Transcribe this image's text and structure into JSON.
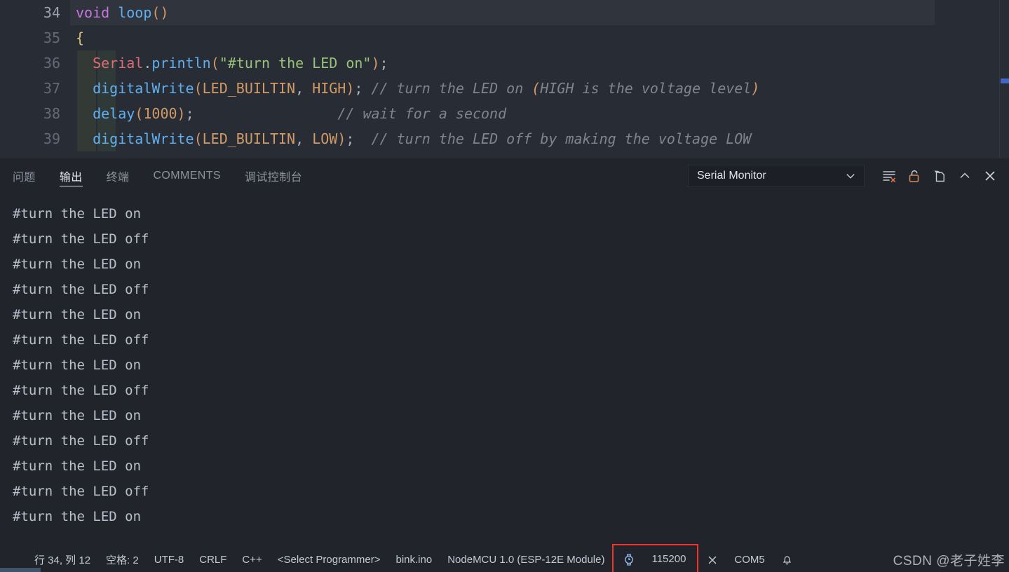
{
  "editor": {
    "lines": [
      {
        "number": "34",
        "active": true,
        "indent_guides": 0,
        "tokens": [
          {
            "t": "void",
            "c": "t-kw"
          },
          {
            "t": " ",
            "c": "t-plain"
          },
          {
            "t": "loop",
            "c": "t-fn"
          },
          {
            "t": "(",
            "c": "t-paren"
          },
          {
            "t": ")",
            "c": "t-paren"
          }
        ]
      },
      {
        "number": "35",
        "active": false,
        "indent_guides": 0,
        "tokens": [
          {
            "t": "{",
            "c": "t-brace"
          }
        ]
      },
      {
        "number": "36",
        "active": false,
        "indent_guides": 2,
        "tokens": [
          {
            "t": "  ",
            "c": "t-plain"
          },
          {
            "t": "Serial",
            "c": "t-obj"
          },
          {
            "t": ".",
            "c": "t-plain"
          },
          {
            "t": "println",
            "c": "t-fn"
          },
          {
            "t": "(",
            "c": "t-paren"
          },
          {
            "t": "\"#turn the LED on\"",
            "c": "t-str"
          },
          {
            "t": ")",
            "c": "t-paren"
          },
          {
            "t": ";",
            "c": "t-semi"
          }
        ]
      },
      {
        "number": "37",
        "active": false,
        "indent_guides": 2,
        "tokens": [
          {
            "t": "  ",
            "c": "t-plain"
          },
          {
            "t": "digitalWrite",
            "c": "t-fn"
          },
          {
            "t": "(",
            "c": "t-paren"
          },
          {
            "t": "LED_BUILTIN",
            "c": "t-const"
          },
          {
            "t": ", ",
            "c": "t-plain"
          },
          {
            "t": "HIGH",
            "c": "t-const"
          },
          {
            "t": ")",
            "c": "t-paren"
          },
          {
            "t": ";",
            "c": "t-semi"
          },
          {
            "t": " // turn the LED on ",
            "c": "t-cmt"
          },
          {
            "t": "(",
            "c": "t-cmt-paren"
          },
          {
            "t": "HIGH is the voltage level",
            "c": "t-cmt"
          },
          {
            "t": ")",
            "c": "t-cmt-paren"
          }
        ]
      },
      {
        "number": "38",
        "active": false,
        "indent_guides": 2,
        "tokens": [
          {
            "t": "  ",
            "c": "t-plain"
          },
          {
            "t": "delay",
            "c": "t-fn"
          },
          {
            "t": "(",
            "c": "t-paren"
          },
          {
            "t": "1000",
            "c": "t-const"
          },
          {
            "t": ")",
            "c": "t-paren"
          },
          {
            "t": ";",
            "c": "t-semi"
          },
          {
            "t": "                 // wait for a second",
            "c": "t-cmt"
          }
        ]
      },
      {
        "number": "39",
        "active": false,
        "indent_guides": 2,
        "tokens": [
          {
            "t": "  ",
            "c": "t-plain"
          },
          {
            "t": "digitalWrite",
            "c": "t-fn"
          },
          {
            "t": "(",
            "c": "t-paren"
          },
          {
            "t": "LED_BUILTIN",
            "c": "t-const"
          },
          {
            "t": ", ",
            "c": "t-plain"
          },
          {
            "t": "LOW",
            "c": "t-const"
          },
          {
            "t": ")",
            "c": "t-paren"
          },
          {
            "t": ";",
            "c": "t-semi"
          },
          {
            "t": "  // turn the LED off by making the voltage LOW",
            "c": "t-cmt"
          }
        ]
      }
    ]
  },
  "panel": {
    "tabs": [
      {
        "label": "问题",
        "active": false,
        "name": "tab-problems"
      },
      {
        "label": "输出",
        "active": true,
        "name": "tab-output"
      },
      {
        "label": "终端",
        "active": false,
        "name": "tab-terminal"
      },
      {
        "label": "COMMENTS",
        "active": false,
        "name": "tab-comments"
      },
      {
        "label": "调试控制台",
        "active": false,
        "name": "tab-debug-console"
      }
    ],
    "channel_selected": "Serial Monitor",
    "actions": [
      {
        "name": "clear-output-icon",
        "title": "清除输出"
      },
      {
        "name": "unlock-icon",
        "title": "解锁滚动"
      },
      {
        "name": "open-new-window-icon",
        "title": "在新窗口中打开"
      },
      {
        "name": "collapse-panel-icon",
        "title": "折叠面板"
      },
      {
        "name": "close-panel-icon",
        "title": "关闭面板"
      }
    ]
  },
  "output": {
    "lines": [
      "#turn the LED on",
      "#turn the LED off",
      "#turn the LED on",
      "#turn the LED off",
      "#turn the LED on",
      "#turn the LED off",
      "#turn the LED on",
      "#turn the LED off",
      "#turn the LED on",
      "#turn the LED off",
      "#turn the LED on",
      "#turn the LED off",
      "#turn the LED on"
    ]
  },
  "statusbar": {
    "cursor_position": "行 34, 列 12",
    "indentation": "空格: 2",
    "encoding": "UTF-8",
    "eol": "CRLF",
    "language": "C++",
    "programmer": "<Select Programmer>",
    "sketch": "bink.ino",
    "board": "NodeMCU 1.0 (ESP-12E Module)",
    "baud_rate": "115200",
    "baud_icon": "watch-icon",
    "disconnect_label": "✕",
    "port": "COM5",
    "notification_icon": "bell-icon",
    "highlight_color": "#f0342a",
    "watermark": "CSDN @老子姓李"
  }
}
